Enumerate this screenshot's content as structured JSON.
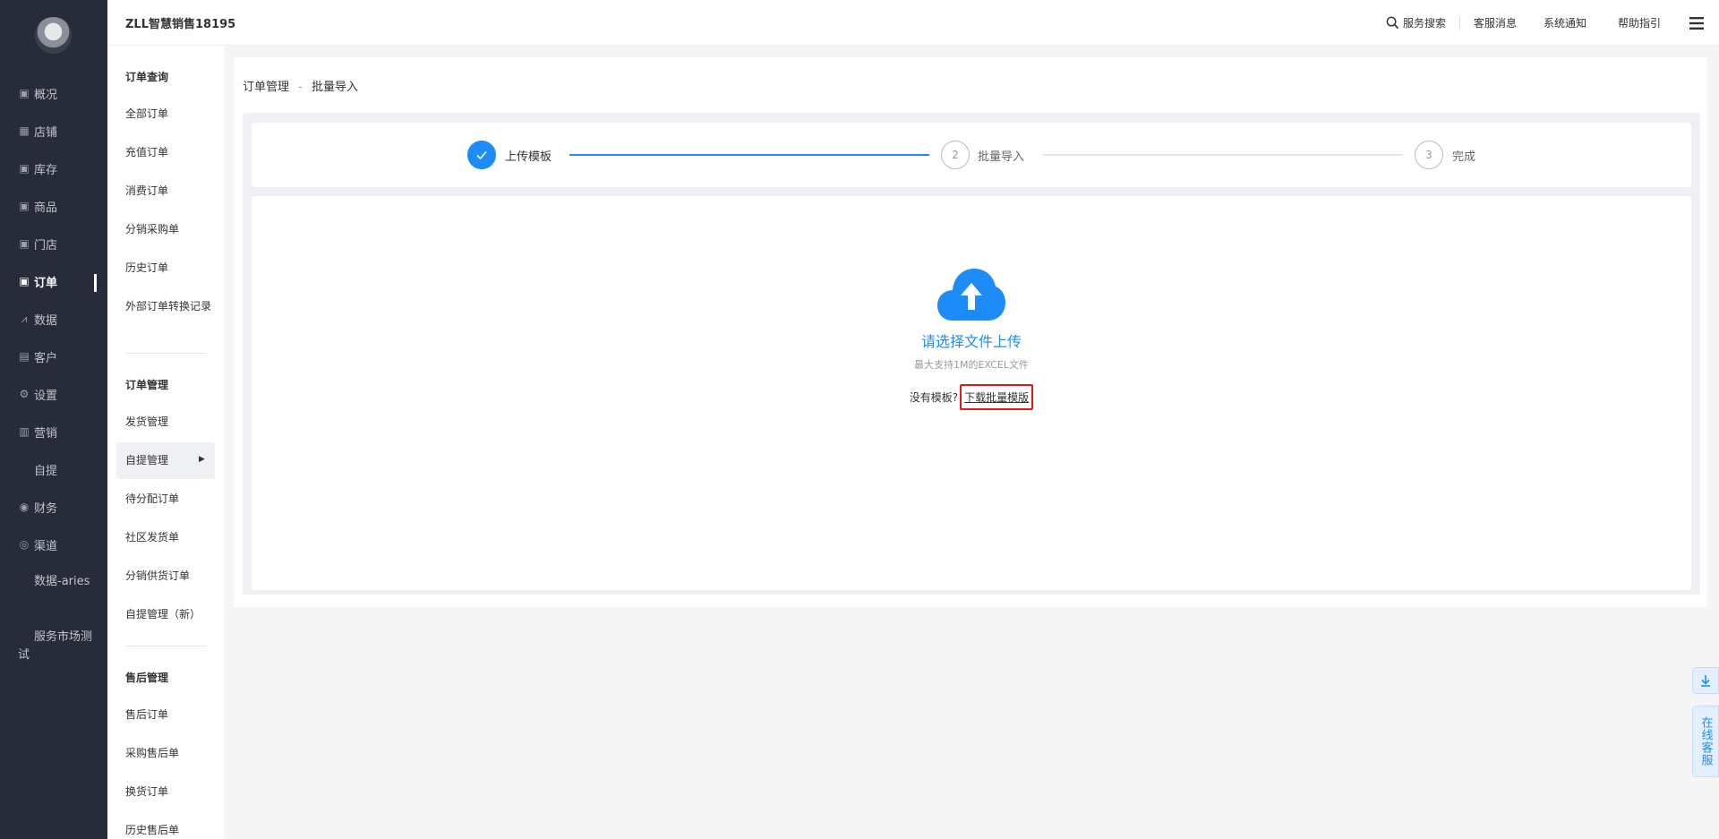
{
  "shop_name": "ZLL智慧销售18195",
  "top_links": {
    "search": "服务搜索",
    "customer_msg": "客服消息",
    "system_notice": "系统通知",
    "help": "帮助指引"
  },
  "left_nav": [
    {
      "label": "概况",
      "icon": "box-icon"
    },
    {
      "label": "店铺",
      "icon": "store-icon"
    },
    {
      "label": "库存",
      "icon": "box-icon"
    },
    {
      "label": "商品",
      "icon": "box-icon"
    },
    {
      "label": "门店",
      "icon": "box-icon"
    },
    {
      "label": "订单",
      "icon": "box-icon",
      "active": true
    },
    {
      "label": "数据",
      "icon": "chart-icon"
    },
    {
      "label": "客户",
      "icon": "card-icon"
    },
    {
      "label": "设置",
      "icon": "gear-icon"
    },
    {
      "label": "营销",
      "icon": "bar-icon"
    },
    {
      "label": "自提",
      "icon": ""
    },
    {
      "label": "财务",
      "icon": "coin-icon"
    },
    {
      "label": "渠道",
      "icon": "chat-icon"
    }
  ],
  "left_nav_extra": [
    "数据-aries",
    "服务市场测试"
  ],
  "sub_nav": {
    "group1_title": "订单查询",
    "group1_items": [
      "全部订单",
      "充值订单",
      "消费订单",
      "分销采购单",
      "历史订单",
      "外部订单转换记录"
    ],
    "group2_title": "订单管理",
    "group2_items": [
      "发货管理",
      "自提管理",
      "待分配订单",
      "社区发货单",
      "分销供货订单",
      "自提管理（新）"
    ],
    "group3_title": "售后管理",
    "group3_items": [
      "售后订单",
      "采购售后单",
      "换货订单",
      "历史售后单"
    ]
  },
  "breadcrumb": {
    "parent": "订单管理",
    "separator": "-",
    "current": "批量导入"
  },
  "steps": [
    {
      "number": "✓",
      "label": "上传模板",
      "done": true
    },
    {
      "number": "2",
      "label": "批量导入",
      "done": false
    },
    {
      "number": "3",
      "label": "完成",
      "done": false
    }
  ],
  "upload": {
    "title": "请选择文件上传",
    "hint": "最大支持1M的EXCEL文件",
    "no_template_text": "没有模板?",
    "download_link": "下载批量模版"
  },
  "float": {
    "service": "在线客服"
  },
  "colors": {
    "accent": "#1d8cf8",
    "nav_bg": "#282c3a",
    "highlight": "#e61919"
  }
}
